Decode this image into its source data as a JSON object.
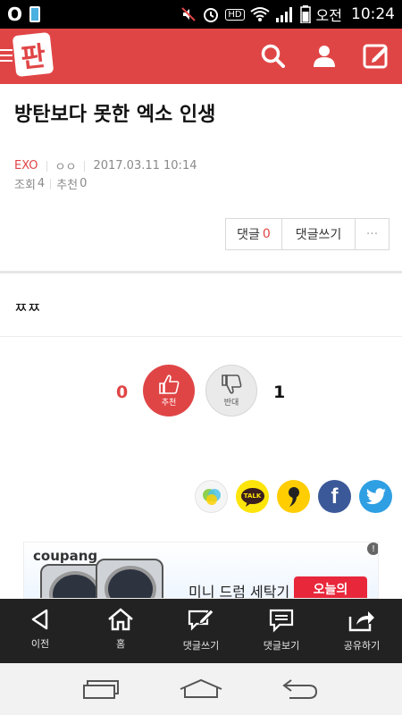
{
  "status_bar": {
    "carrier_icon": "carrier-o-icon",
    "ampm": "오전",
    "time": "10:24",
    "hd_badge": "HD"
  },
  "app_bar": {
    "logo_text": "판",
    "accent_color": "#e04546"
  },
  "post": {
    "title": "방탄보다 못한 엑소 인생",
    "board": "EXO",
    "author": "ㅇㅇ",
    "datetime": "2017.03.11 10:14",
    "views_label": "조회",
    "views": "4",
    "recommend_label": "추천",
    "recommend": "0",
    "body": "ㅉㅉ"
  },
  "comment_buttons": {
    "comments_label": "댓글",
    "comments_count": "0",
    "write_label": "댓글쓰기",
    "more_label": "···"
  },
  "vote": {
    "up_count": "0",
    "up_label": "추천",
    "down_label": "반대",
    "down_count": "1"
  },
  "share": {
    "items": [
      {
        "name": "kakaostory-icon",
        "color": "#f5f5f5"
      },
      {
        "name": "kakaotalk-icon",
        "color": "#fde40a"
      },
      {
        "name": "kakao-page-icon",
        "color": "#ffcd00"
      },
      {
        "name": "facebook-icon",
        "color": "#3b5998"
      },
      {
        "name": "twitter-icon",
        "color": "#2f9fe3"
      }
    ],
    "talk_text": "TALK",
    "f_text": "f"
  },
  "ad": {
    "brand": "coupang",
    "text": "미니 드럼 세탁기",
    "cta": "오늘의",
    "info": "!"
  },
  "bottom_nav": [
    {
      "label": "이전",
      "icon": "back-arrow-icon"
    },
    {
      "label": "홈",
      "icon": "home-icon"
    },
    {
      "label": "댓글쓰기",
      "icon": "write-comment-icon"
    },
    {
      "label": "댓글보기",
      "icon": "view-comments-icon"
    },
    {
      "label": "공유하기",
      "icon": "share-icon"
    }
  ]
}
